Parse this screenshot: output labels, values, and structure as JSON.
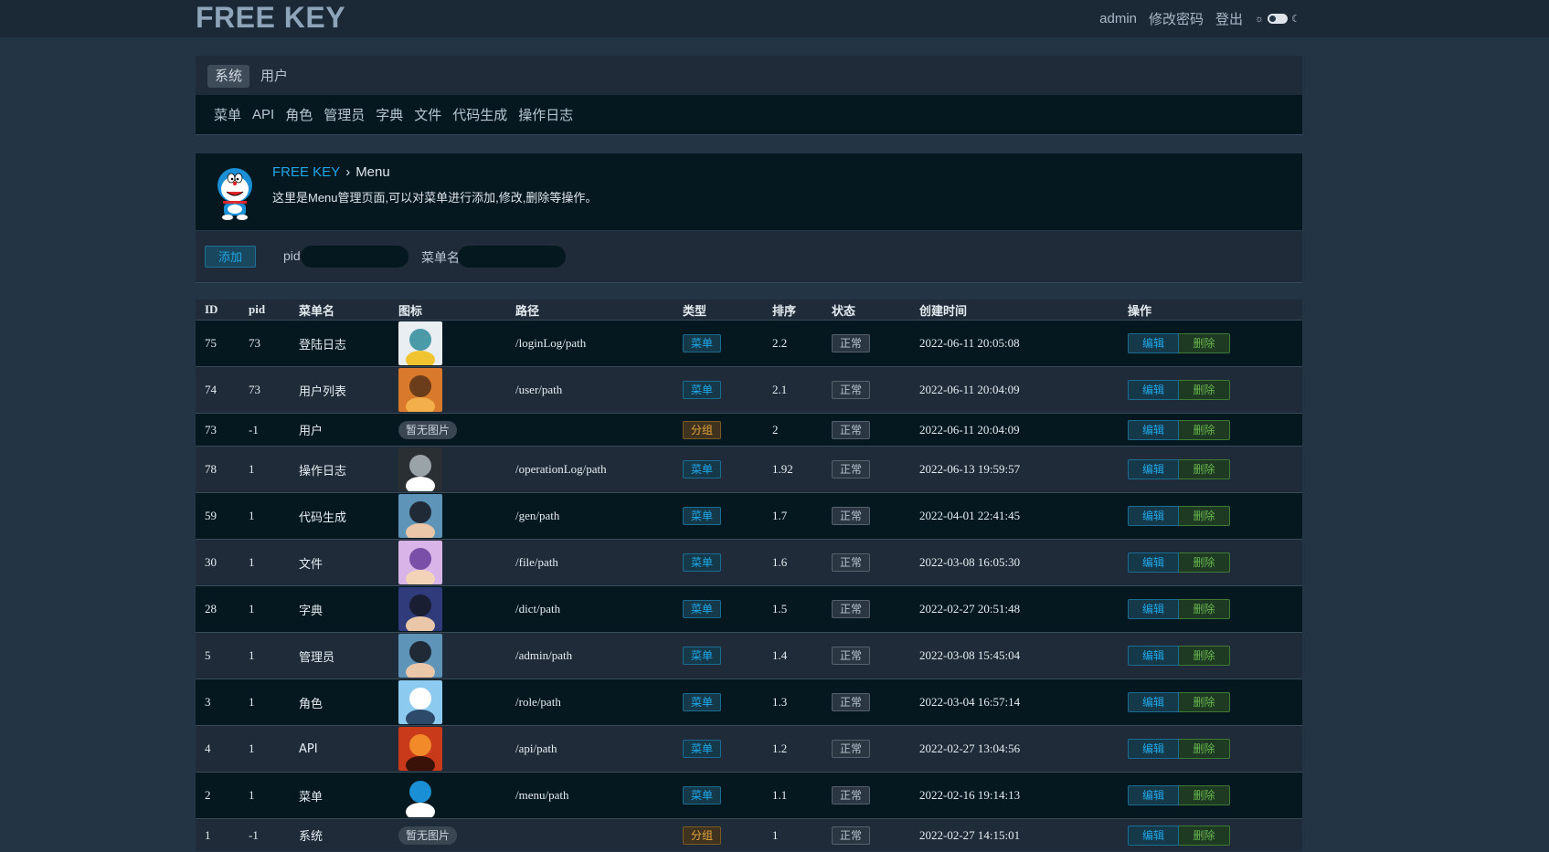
{
  "app": {
    "logo": "FREE KEY"
  },
  "topbar": {
    "user": "admin",
    "change_password": "修改密码",
    "logout": "登出"
  },
  "nav": {
    "tabs": [
      {
        "label": "系统",
        "active": true
      },
      {
        "label": "用户",
        "active": false
      }
    ],
    "sub_items": [
      "菜单",
      "API",
      "角色",
      "管理员",
      "字典",
      "文件",
      "代码生成",
      "操作日志"
    ]
  },
  "header": {
    "breadcrumb_home": "FREE KEY",
    "breadcrumb_sep": "›",
    "breadcrumb_current": "Menu",
    "description": "这里是Menu管理页面,可以对菜单进行添加,修改,删除等操作。",
    "avatar_icon": "doraemon-avatar-icon"
  },
  "filter": {
    "add_label": "添加",
    "pid_label": "pid",
    "pid_value": "",
    "name_label": "菜单名",
    "name_value": ""
  },
  "table": {
    "columns": [
      "ID",
      "pid",
      "菜单名",
      "图标",
      "路径",
      "类型",
      "排序",
      "状态",
      "创建时间",
      "操作"
    ],
    "edit_label": "编辑",
    "delete_label": "删除",
    "rows": [
      {
        "id": "75",
        "pid": "73",
        "name": "登陆日志",
        "icon": "monster-image-icon",
        "path": "/loginLog/path",
        "type": "菜单",
        "sort": "2.2",
        "status": "正常",
        "created": "2022-06-11 20:05:08"
      },
      {
        "id": "74",
        "pid": "73",
        "name": "用户列表",
        "icon": "autumn-forest-image-icon",
        "path": "/user/path",
        "type": "菜单",
        "sort": "2.1",
        "status": "正常",
        "created": "2022-06-11 20:04:09"
      },
      {
        "id": "73",
        "pid": "-1",
        "name": "用户",
        "icon": "",
        "no_image": "暂无图片",
        "path": "",
        "type": "分组",
        "sort": "2",
        "status": "正常",
        "created": "2022-06-11 20:04:09"
      },
      {
        "id": "78",
        "pid": "1",
        "name": "操作日志",
        "icon": "skull-image-icon",
        "path": "/operationLog/path",
        "type": "菜单",
        "sort": "1.92",
        "status": "正常",
        "created": "2022-06-13 19:59:57"
      },
      {
        "id": "59",
        "pid": "1",
        "name": "代码生成",
        "icon": "anime-boy-image-icon",
        "path": "/gen/path",
        "type": "菜单",
        "sort": "1.7",
        "status": "正常",
        "created": "2022-04-01 22:41:45"
      },
      {
        "id": "30",
        "pid": "1",
        "name": "文件",
        "icon": "anime-girl-image-icon",
        "path": "/file/path",
        "type": "菜单",
        "sort": "1.6",
        "status": "正常",
        "created": "2022-03-08 16:05:30"
      },
      {
        "id": "28",
        "pid": "1",
        "name": "字典",
        "icon": "detective-image-icon",
        "path": "/dict/path",
        "type": "菜单",
        "sort": "1.5",
        "status": "正常",
        "created": "2022-02-27 20:51:48"
      },
      {
        "id": "5",
        "pid": "1",
        "name": "管理员",
        "icon": "anime-boy-image-icon",
        "path": "/admin/path",
        "type": "菜单",
        "sort": "1.4",
        "status": "正常",
        "created": "2022-03-08 15:45:04"
      },
      {
        "id": "3",
        "pid": "1",
        "name": "角色",
        "icon": "sky-boy-image-icon",
        "path": "/role/path",
        "type": "菜单",
        "sort": "1.3",
        "status": "正常",
        "created": "2022-03-04 16:57:14"
      },
      {
        "id": "4",
        "pid": "1",
        "name": "API",
        "icon": "fire-creature-image-icon",
        "path": "/api/path",
        "type": "菜单",
        "sort": "1.2",
        "status": "正常",
        "created": "2022-02-27 13:04:56"
      },
      {
        "id": "2",
        "pid": "1",
        "name": "菜单",
        "icon": "doraemon-image-icon",
        "path": "/menu/path",
        "type": "菜单",
        "sort": "1.1",
        "status": "正常",
        "created": "2022-02-16 19:14:13"
      },
      {
        "id": "1",
        "pid": "-1",
        "name": "系统",
        "icon": "",
        "no_image": "暂无图片",
        "path": "",
        "type": "分组",
        "sort": "1",
        "status": "正常",
        "created": "2022-02-27 14:15:01"
      }
    ]
  }
}
